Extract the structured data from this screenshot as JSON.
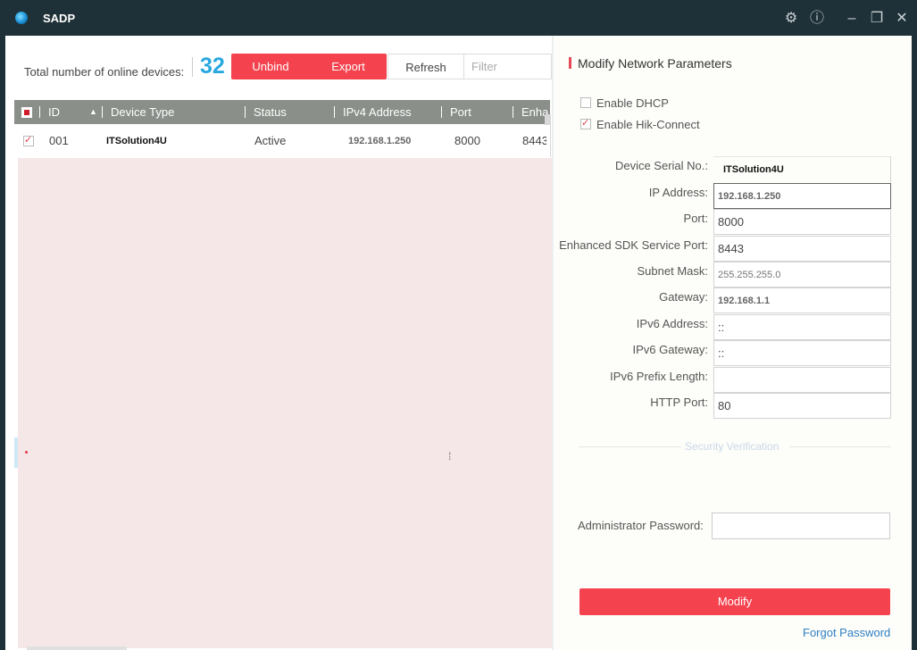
{
  "window": {
    "title": "SADP"
  },
  "toolbar": {
    "total_label": "Total number of online devices:",
    "device_count": "32",
    "unbind_label": "Unbind",
    "export_label": "Export",
    "refresh_label": "Refresh",
    "filter_placeholder": "Filter"
  },
  "table": {
    "headers": {
      "id": "ID",
      "device_type": "Device Type",
      "status": "Status",
      "ipv4": "IPv4 Address",
      "port": "Port",
      "enhanced": "Enha"
    },
    "rows": [
      {
        "id": "001",
        "device_type": "ITSolution4U",
        "status": "Active",
        "ipv4": "192.168.1.250",
        "port": "8000",
        "enhanced": "8443"
      }
    ]
  },
  "panel": {
    "title": "Modify Network Parameters",
    "enable_dhcp": "Enable DHCP",
    "enable_hik": "Enable Hik-Connect",
    "fields": {
      "serial_label": "Device Serial No.:",
      "serial_value": "ITSolution4U",
      "ip_label": "IP Address:",
      "ip_value": "192.168.1.250",
      "port_label": "Port:",
      "port_value": "8000",
      "sdk_label": "Enhanced SDK Service Port:",
      "sdk_value": "8443",
      "mask_label": "Subnet Mask:",
      "mask_value": "255.255.255.0",
      "gateway_label": "Gateway:",
      "gateway_value": "192.168.1.1",
      "ipv6_label": "IPv6 Address:",
      "ipv6_value": "::",
      "ipv6gw_label": "IPv6 Gateway:",
      "ipv6gw_value": "::",
      "prefix_label": "IPv6 Prefix Length:",
      "prefix_value": "",
      "http_label": "HTTP Port:",
      "http_value": "80"
    },
    "security_label": "Security Verification",
    "admin_label": "Administrator Password:",
    "modify_label": "Modify",
    "forgot_label": "Forgot Password"
  },
  "icons": {
    "settings": "gear-icon",
    "info": "info-icon",
    "minimize": "minimize-icon",
    "maximize": "maximize-icon",
    "close": "close-icon",
    "sort": "sort-asc-icon"
  },
  "colors": {
    "accent_red": "#f4434e",
    "count_blue": "#29a8e0",
    "titlebar": "#1f3138",
    "link": "#2f7fc1"
  }
}
